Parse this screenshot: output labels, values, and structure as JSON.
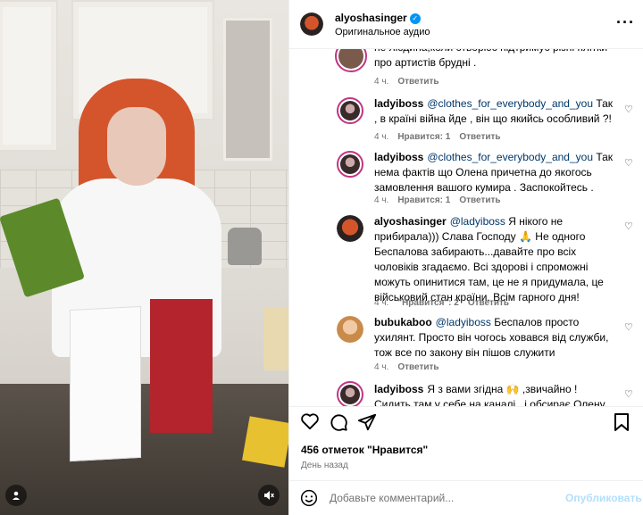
{
  "post": {
    "username": "alyoshasinger",
    "audio": "Оригинальное аудио",
    "more_icon": "more-horizontal-icon"
  },
  "comments": [
    {
      "text": "не людина,коли створює підтримує різні плітки про артистів брудні .",
      "age": "4 ч.",
      "reply": "Ответить"
    },
    {
      "username": "ladyiboss",
      "mention": "@clothes_for_everybody_and_you",
      "text": " Так , в країні війна йде , він що якийсь особливий ?!",
      "age": "4 ч.",
      "likes": "Нравится: 1",
      "reply": "Ответить"
    },
    {
      "username": "ladyiboss",
      "mention": "@clothes_for_everybody_and_you",
      "text": " Так нема фактів що Олена причетна до якогось замовлення вашого кумира . Заспокойтесь .",
      "age": "4 ч.",
      "likes": "Нравится: 1",
      "reply": "Ответить"
    },
    {
      "username": "alyoshasinger",
      "mention": "@ladyiboss",
      "text": " Я нікого не прибирала))) Слава Господу 🙏 Не одного Беспалова забирають...давайте про всіх чоловіків згадаємо. Всі здорові і спроможні можуть опинитися там, це не я придумала, це військовий стан країни. Всім гарного дня!",
      "age": "4 ч.",
      "likes": "\"Нравится\": 2",
      "reply": "Ответить"
    },
    {
      "username": "bubukaboo",
      "mention": "@ladyiboss",
      "text": " Беспалов просто ухилянт. Просто він чогось ховався від служби, тож все по закону він пішов служити",
      "age": "4 ч.",
      "reply": "Ответить"
    },
    {
      "username": "ladyiboss",
      "text": "Я з вами згідна 🙌 ,звичайно ! Сидить там у себе на каналі , і обсирає Олену. Тіну",
      "age": "",
      "reply": ""
    }
  ],
  "actions": {
    "likes": "456 отметок \"Нравится\"",
    "date": "День назад"
  },
  "add_comment": {
    "placeholder": "Добавьте комментарий...",
    "publish": "Опубликовать"
  },
  "colors": {
    "link": "#00376b",
    "publish": "#b2dffc",
    "verified": "#0095f6"
  }
}
